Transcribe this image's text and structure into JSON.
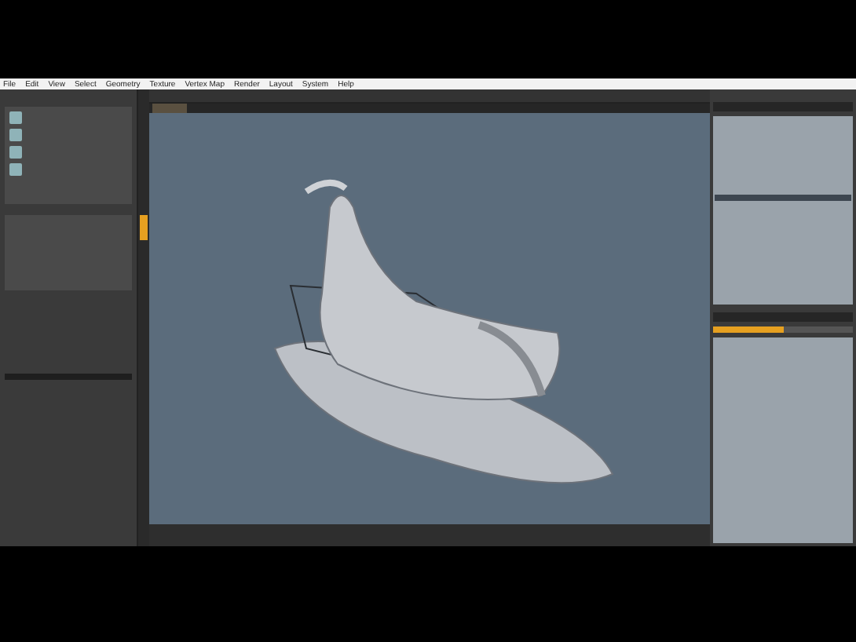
{
  "menu": [
    "File",
    "Edit",
    "View",
    "Select",
    "Geometry",
    "Texture",
    "Vertex Map",
    "Render",
    "Layout",
    "System",
    "Help"
  ],
  "progress": {
    "level": 0.5
  }
}
